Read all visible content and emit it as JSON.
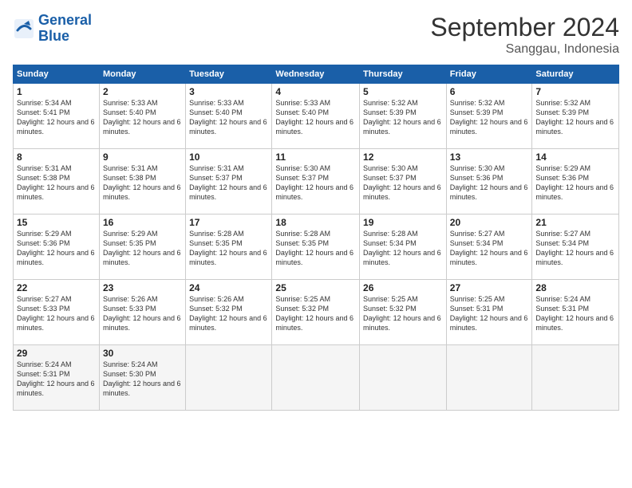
{
  "header": {
    "logo_line1": "General",
    "logo_line2": "Blue",
    "month_title": "September 2024",
    "subtitle": "Sanggau, Indonesia"
  },
  "days_of_week": [
    "Sunday",
    "Monday",
    "Tuesday",
    "Wednesday",
    "Thursday",
    "Friday",
    "Saturday"
  ],
  "weeks": [
    [
      {
        "num": "1",
        "sunrise": "5:34 AM",
        "sunset": "5:41 PM",
        "daylight": "12 hours and 6 minutes."
      },
      {
        "num": "2",
        "sunrise": "5:33 AM",
        "sunset": "5:40 PM",
        "daylight": "12 hours and 6 minutes."
      },
      {
        "num": "3",
        "sunrise": "5:33 AM",
        "sunset": "5:40 PM",
        "daylight": "12 hours and 6 minutes."
      },
      {
        "num": "4",
        "sunrise": "5:33 AM",
        "sunset": "5:40 PM",
        "daylight": "12 hours and 6 minutes."
      },
      {
        "num": "5",
        "sunrise": "5:32 AM",
        "sunset": "5:39 PM",
        "daylight": "12 hours and 6 minutes."
      },
      {
        "num": "6",
        "sunrise": "5:32 AM",
        "sunset": "5:39 PM",
        "daylight": "12 hours and 6 minutes."
      },
      {
        "num": "7",
        "sunrise": "5:32 AM",
        "sunset": "5:39 PM",
        "daylight": "12 hours and 6 minutes."
      }
    ],
    [
      {
        "num": "8",
        "sunrise": "5:31 AM",
        "sunset": "5:38 PM",
        "daylight": "12 hours and 6 minutes."
      },
      {
        "num": "9",
        "sunrise": "5:31 AM",
        "sunset": "5:38 PM",
        "daylight": "12 hours and 6 minutes."
      },
      {
        "num": "10",
        "sunrise": "5:31 AM",
        "sunset": "5:37 PM",
        "daylight": "12 hours and 6 minutes."
      },
      {
        "num": "11",
        "sunrise": "5:30 AM",
        "sunset": "5:37 PM",
        "daylight": "12 hours and 6 minutes."
      },
      {
        "num": "12",
        "sunrise": "5:30 AM",
        "sunset": "5:37 PM",
        "daylight": "12 hours and 6 minutes."
      },
      {
        "num": "13",
        "sunrise": "5:30 AM",
        "sunset": "5:36 PM",
        "daylight": "12 hours and 6 minutes."
      },
      {
        "num": "14",
        "sunrise": "5:29 AM",
        "sunset": "5:36 PM",
        "daylight": "12 hours and 6 minutes."
      }
    ],
    [
      {
        "num": "15",
        "sunrise": "5:29 AM",
        "sunset": "5:36 PM",
        "daylight": "12 hours and 6 minutes."
      },
      {
        "num": "16",
        "sunrise": "5:29 AM",
        "sunset": "5:35 PM",
        "daylight": "12 hours and 6 minutes."
      },
      {
        "num": "17",
        "sunrise": "5:28 AM",
        "sunset": "5:35 PM",
        "daylight": "12 hours and 6 minutes."
      },
      {
        "num": "18",
        "sunrise": "5:28 AM",
        "sunset": "5:35 PM",
        "daylight": "12 hours and 6 minutes."
      },
      {
        "num": "19",
        "sunrise": "5:28 AM",
        "sunset": "5:34 PM",
        "daylight": "12 hours and 6 minutes."
      },
      {
        "num": "20",
        "sunrise": "5:27 AM",
        "sunset": "5:34 PM",
        "daylight": "12 hours and 6 minutes."
      },
      {
        "num": "21",
        "sunrise": "5:27 AM",
        "sunset": "5:34 PM",
        "daylight": "12 hours and 6 minutes."
      }
    ],
    [
      {
        "num": "22",
        "sunrise": "5:27 AM",
        "sunset": "5:33 PM",
        "daylight": "12 hours and 6 minutes."
      },
      {
        "num": "23",
        "sunrise": "5:26 AM",
        "sunset": "5:33 PM",
        "daylight": "12 hours and 6 minutes."
      },
      {
        "num": "24",
        "sunrise": "5:26 AM",
        "sunset": "5:32 PM",
        "daylight": "12 hours and 6 minutes."
      },
      {
        "num": "25",
        "sunrise": "5:25 AM",
        "sunset": "5:32 PM",
        "daylight": "12 hours and 6 minutes."
      },
      {
        "num": "26",
        "sunrise": "5:25 AM",
        "sunset": "5:32 PM",
        "daylight": "12 hours and 6 minutes."
      },
      {
        "num": "27",
        "sunrise": "5:25 AM",
        "sunset": "5:31 PM",
        "daylight": "12 hours and 6 minutes."
      },
      {
        "num": "28",
        "sunrise": "5:24 AM",
        "sunset": "5:31 PM",
        "daylight": "12 hours and 6 minutes."
      }
    ],
    [
      {
        "num": "29",
        "sunrise": "5:24 AM",
        "sunset": "5:31 PM",
        "daylight": "12 hours and 6 minutes."
      },
      {
        "num": "30",
        "sunrise": "5:24 AM",
        "sunset": "5:30 PM",
        "daylight": "12 hours and 6 minutes."
      },
      null,
      null,
      null,
      null,
      null
    ]
  ]
}
